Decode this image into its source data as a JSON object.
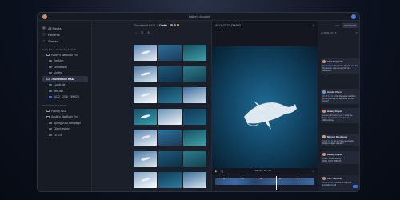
{
  "window": {
    "title": "Hailey's Account"
  },
  "sidebar": {
    "nav": [
      {
        "label": "All Media",
        "icon": "grid-icon"
      },
      {
        "label": "Recents",
        "icon": "clock-icon"
      },
      {
        "label": "Starred",
        "icon": "star-icon"
      }
    ],
    "connections_header": "HAILEY'S CONNECTIONS",
    "connections": [
      {
        "label": "Hailey's MacBook Pro",
        "type": "device",
        "chev": "⌄"
      },
      {
        "label": "Desktop",
        "type": "folder"
      },
      {
        "label": "Downloads",
        "type": "folder"
      },
      {
        "label": "Movies",
        "type": "folder"
      },
      {
        "label": "Thunderbolt RAID",
        "type": "device-active",
        "chev": "⌄"
      },
      {
        "label": "LucidLink",
        "type": "folder"
      },
      {
        "label": "NetDisk",
        "type": "folder"
      },
      {
        "label": "A012_C006_Z8K920",
        "type": "folder-blue"
      }
    ],
    "shared_header": "SHARED WITH ME",
    "shared": [
      {
        "label": "Frankly NAS",
        "type": "device",
        "chev": "›"
      },
      {
        "label": "Austin's MacBook Pro",
        "type": "device",
        "chev": "⌄"
      },
      {
        "label": "Spring 2024 campaign",
        "type": "folder"
      },
      {
        "label": "Client review",
        "type": "folder"
      },
      {
        "label": "LUTDir",
        "type": "folder"
      }
    ]
  },
  "thumbs": {
    "crumb_parent": "Thunderbolt RAID",
    "crumb_sep": "›",
    "crumb_current": "Drafts",
    "tools": [
      "⌕",
      "☰",
      "⚙"
    ]
  },
  "viewer": {
    "file": "A012_C017_Z8K920",
    "timecode": "01:23:12:15"
  },
  "comments": {
    "tabs": [
      "Info",
      "Comments"
    ],
    "header": "COMMENTS",
    "items": [
      {
        "author": "Alex Sapinski",
        "time": "00:08:08:11",
        "text": "Nice shot, I like this one for the opener. Can we get this one stabilized?",
        "color": "#c98c6a"
      },
      {
        "author": "Austin Chen",
        "time": "00:25:14:11",
        "text": "Is this the same rendition as the last one we approved for this scene?",
        "color": "#7b8fd8"
      },
      {
        "author": "Hailey Royal",
        "time": "",
        "text": "Let me get back to you. I think the latest exports have come from a different day.",
        "color": "#d88a6a"
      },
      {
        "author": "Margot Bredshaw",
        "time": "01:02:23:11",
        "text": "Do we have an overlay that is a higher altitude?",
        "color": "#c9a06a"
      },
      {
        "author": "Hailey Royal",
        "time": "",
        "text": "Yeah - Check the clip A012_C017_Z8K920",
        "color": "#d88a6a"
      }
    ],
    "composer": {
      "author": "Alex Sapinski",
      "time": "00:14:12:01",
      "text": "This would make for incredible b-roll"
    }
  },
  "colors": {
    "accent": "#3b6fe0",
    "ocean": "#0c2436"
  }
}
